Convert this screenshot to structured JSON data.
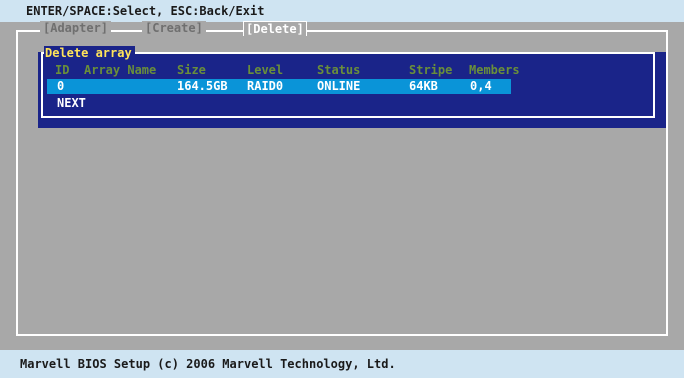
{
  "hint_bar": {
    "text": "ENTER/SPACE:Select, ESC:Back/Exit"
  },
  "tabs": [
    {
      "label": "[Adapter]",
      "active": false
    },
    {
      "label": "[Create]",
      "active": false
    },
    {
      "label": "[Delete]",
      "active": true
    }
  ],
  "delete_array": {
    "title": "Delete array",
    "columns": [
      "ID",
      "Array Name",
      "Size",
      "Level",
      "Status",
      "Stripe",
      "Members"
    ],
    "rows": [
      {
        "id": "0",
        "array_name": "",
        "size": "164.5GB",
        "level": "RAID0",
        "status": "ONLINE",
        "stripe": "64KB",
        "members": "0,4",
        "selected": true
      }
    ],
    "next_label": "NEXT"
  },
  "footer": {
    "text": "Marvell BIOS Setup (c) 2006 Marvell Technology, Ltd."
  },
  "colors": {
    "background_gray": "#a8a8a8",
    "bar_light_blue": "#cfe4f2",
    "panel_navy": "#1a2489",
    "selection_blue": "#0a94d8",
    "title_yellow": "#ffe45a",
    "header_green": "#6a8f3a",
    "inactive_tab_gray": "#6f6f6f"
  }
}
